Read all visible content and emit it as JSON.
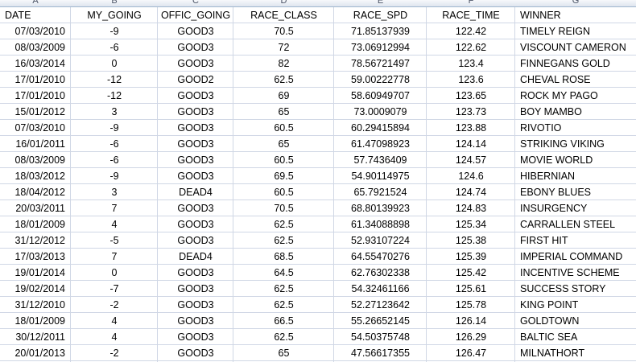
{
  "column_letters": [
    "A",
    "B",
    "C",
    "D",
    "E",
    "F",
    "G"
  ],
  "headers": [
    "DATE",
    "MY_GOING",
    "OFFIC_GOING",
    "RACE_CLASS",
    "RACE_SPD",
    "RACE_TIME",
    "WINNER"
  ],
  "rows": [
    [
      "07/03/2010",
      "-9",
      "GOOD3",
      "70.5",
      "71.85137939",
      "122.42",
      "TIMELY REIGN"
    ],
    [
      "08/03/2009",
      "-6",
      "GOOD3",
      "72",
      "73.06912994",
      "122.62",
      "VISCOUNT CAMERON"
    ],
    [
      "16/03/2014",
      "0",
      "GOOD3",
      "82",
      "78.56721497",
      "123.4",
      "FINNEGANS GOLD"
    ],
    [
      "17/01/2010",
      "-12",
      "GOOD2",
      "62.5",
      "59.00222778",
      "123.6",
      "CHEVAL ROSE"
    ],
    [
      "17/01/2010",
      "-12",
      "GOOD3",
      "69",
      "58.60949707",
      "123.65",
      "ROCK MY PAGO"
    ],
    [
      "15/01/2012",
      "3",
      "GOOD3",
      "65",
      "73.0009079",
      "123.73",
      "BOY MAMBO"
    ],
    [
      "07/03/2010",
      "-9",
      "GOOD3",
      "60.5",
      "60.29415894",
      "123.88",
      "RIVOTIO"
    ],
    [
      "16/01/2011",
      "-6",
      "GOOD3",
      "65",
      "61.47098923",
      "124.14",
      "STRIKING VIKING"
    ],
    [
      "08/03/2009",
      "-6",
      "GOOD3",
      "60.5",
      "57.7436409",
      "124.57",
      "MOVIE WORLD"
    ],
    [
      "18/03/2012",
      "-9",
      "GOOD3",
      "69.5",
      "54.90114975",
      "124.6",
      "HIBERNIAN"
    ],
    [
      "18/04/2012",
      "3",
      "DEAD4",
      "60.5",
      "65.7921524",
      "124.74",
      "EBONY BLUES"
    ],
    [
      "20/03/2011",
      "7",
      "GOOD3",
      "70.5",
      "68.80139923",
      "124.83",
      "INSURGENCY"
    ],
    [
      "18/01/2009",
      "4",
      "GOOD3",
      "62.5",
      "61.34088898",
      "125.34",
      "CARRALLEN STEEL"
    ],
    [
      "31/12/2012",
      "-5",
      "GOOD3",
      "62.5",
      "52.93107224",
      "125.38",
      "FIRST HIT"
    ],
    [
      "17/03/2013",
      "7",
      "DEAD4",
      "68.5",
      "64.55470276",
      "125.39",
      "IMPERIAL COMMAND"
    ],
    [
      "19/01/2014",
      "0",
      "GOOD3",
      "64.5",
      "62.76302338",
      "125.42",
      "INCENTIVE SCHEME"
    ],
    [
      "19/02/2014",
      "-7",
      "GOOD3",
      "62.5",
      "54.32461166",
      "125.61",
      "SUCCESS STORY"
    ],
    [
      "31/12/2010",
      "-2",
      "GOOD3",
      "62.5",
      "52.27123642",
      "125.78",
      "KING POINT"
    ],
    [
      "18/01/2009",
      "4",
      "GOOD3",
      "66.5",
      "55.26652145",
      "126.14",
      "GOLDTOWN"
    ],
    [
      "30/12/2011",
      "4",
      "GOOD3",
      "62.5",
      "54.50375748",
      "126.29",
      "BALTIC SEA"
    ],
    [
      "20/01/2013",
      "-2",
      "GOOD3",
      "65",
      "47.56617355",
      "126.47",
      "MILNATHORT"
    ]
  ]
}
